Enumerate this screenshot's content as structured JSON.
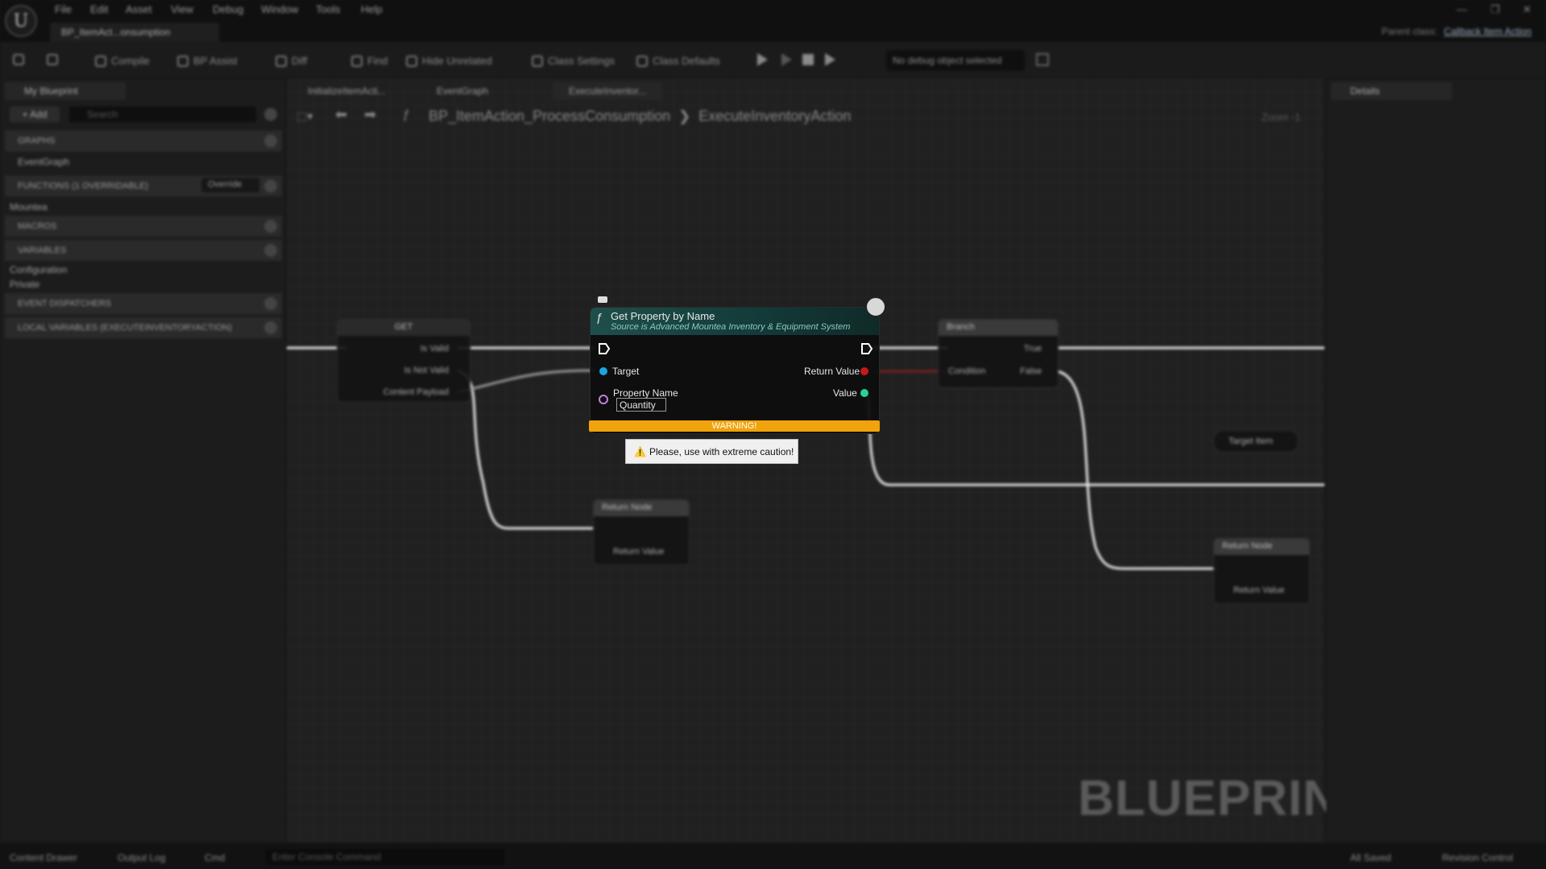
{
  "menu": [
    "File",
    "Edit",
    "Asset",
    "View",
    "Debug",
    "Window",
    "Tools",
    "Help"
  ],
  "asset_tab": "BP_ItemAct...onsumption",
  "parent_class": {
    "label": "Parent class:",
    "value": "Callback Item Action"
  },
  "toolbar": {
    "compile": "Compile",
    "bp_assist": "BP Assist",
    "diff": "Diff",
    "find": "Find",
    "hide_unrelated": "Hide Unrelated",
    "class_settings": "Class Settings",
    "class_defaults": "Class Defaults",
    "debug_object": "No debug object selected"
  },
  "left_panel": {
    "tab": "My Blueprint",
    "add": "+ Add",
    "search_placeholder": "Search",
    "graphs": "GRAPHS",
    "event_graph": "EventGraph",
    "functions": "FUNCTIONS (1 OVERRIDABLE)",
    "override": "Override",
    "mountea": "Mountea",
    "macros": "MACROS",
    "variables": "VARIABLES",
    "configuration": "Configuration",
    "private": "Private",
    "event_dispatchers": "EVENT DISPATCHERS",
    "local_variables": "LOCAL VARIABLES (EXECUTEINVENTORYACTION)"
  },
  "graph_tabs": [
    "InitializeItemActi...",
    "EventGraph",
    "ExecuteInventor..."
  ],
  "breadcrumb": {
    "asset": "BP_ItemAction_ProcessConsumption",
    "function": "ExecuteInventoryAction",
    "zoom": "Zoom -1"
  },
  "watermark": "BLUEPRINT",
  "details_tab": "Details",
  "bottom": {
    "content_drawer": "Content Drawer",
    "output_log": "Output Log",
    "cmd": "Cmd",
    "console_placeholder": "Enter Console Command",
    "all_saved": "All Saved",
    "revision_control": "Revision Control"
  },
  "bg_nodes": {
    "get": {
      "title": "GET",
      "pin1": "Is Valid",
      "pin2": "Is Not Valid",
      "pin3": "Content Payload"
    },
    "branch": {
      "title": "Branch",
      "condition": "Condition",
      "true": "True",
      "false": "False"
    },
    "return1": {
      "title": "Return Node",
      "value": "Return Value"
    },
    "return2": {
      "title": "Return Node",
      "value": "Return Value"
    },
    "target_item": "Target Item"
  },
  "node": {
    "title": "Get Property by Name",
    "subtitle": "Source is Advanced Mountea Inventory & Equipment System",
    "target": "Target",
    "return_value": "Return Value",
    "property_name": "Property Name",
    "property_name_value": "Quantity",
    "value": "Value",
    "warning": "WARNING!",
    "tooltip": "Please, use with extreme caution!"
  },
  "colors": {
    "warning": "#f0a30a",
    "node_header": "#1f4f4a",
    "exec_pin": "#ffffff",
    "object_pin": "#1aa6e6",
    "return_pin": "#c81818",
    "value_pin": "#2ad19a",
    "name_pin": "#c77de0"
  }
}
